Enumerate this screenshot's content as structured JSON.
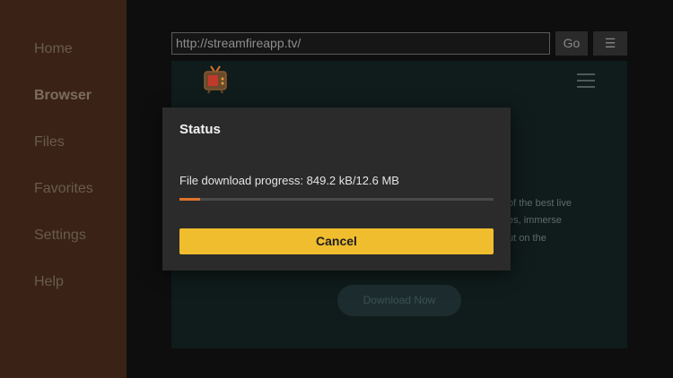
{
  "sidebar": {
    "items": [
      {
        "label": "Home"
      },
      {
        "label": "Browser"
      },
      {
        "label": "Files"
      },
      {
        "label": "Favorites"
      },
      {
        "label": "Settings"
      },
      {
        "label": "Help"
      }
    ],
    "active": "Browser"
  },
  "browser": {
    "url": "http://streamfireapp.tv/",
    "go_label": "Go",
    "menu_icon": "menu-icon"
  },
  "webpage": {
    "logo_icon": "tv-icon",
    "text_lines": [
      "of the best live",
      "es, immerse",
      "ut on the"
    ],
    "download_button": "Download Now"
  },
  "dialog": {
    "title": "Status",
    "progress_text": "File download progress: 849.2 kB/12.6 MB",
    "progress_fraction": 0.0658,
    "cancel_label": "Cancel"
  },
  "colors": {
    "sidebar_bg": "#3a2216",
    "accent_button": "#f0bd2f",
    "progress": "#e0742a"
  }
}
